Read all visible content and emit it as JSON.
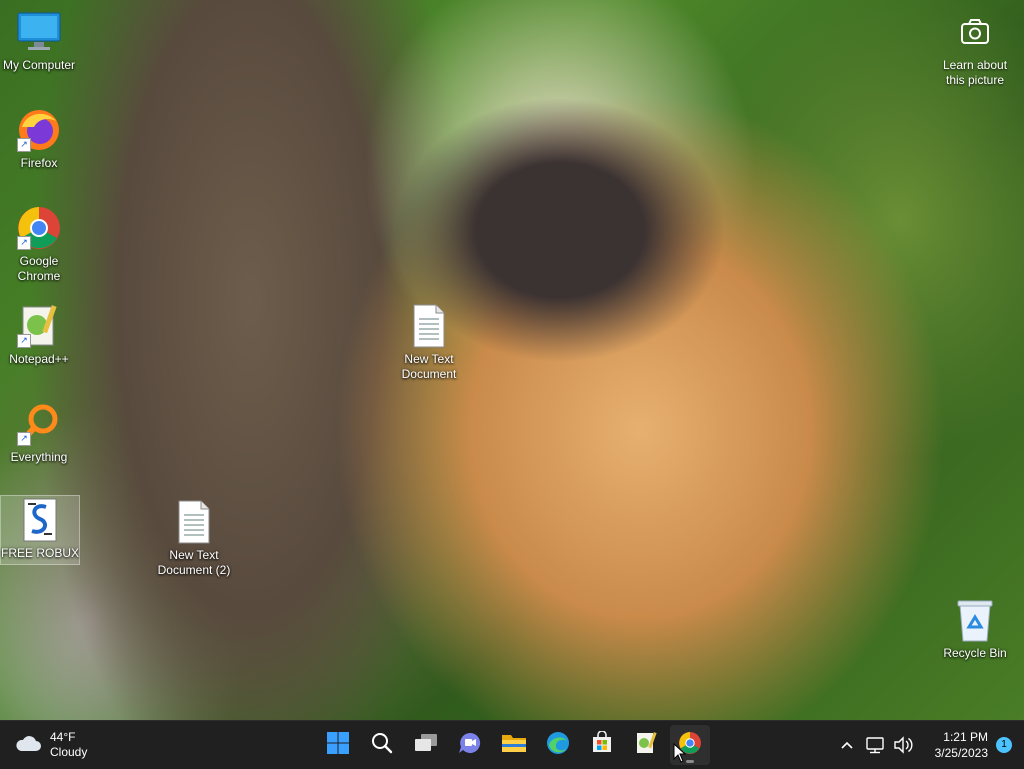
{
  "desktop": {
    "icons": [
      {
        "label": "My Computer",
        "icon": "monitor-icon"
      },
      {
        "label": "Firefox",
        "icon": "firefox-icon"
      },
      {
        "label": "Google Chrome",
        "icon": "chrome-icon"
      },
      {
        "label": "Notepad++",
        "icon": "notepadpp-icon"
      },
      {
        "label": "Everything",
        "icon": "search-everything-icon"
      },
      {
        "label": "FREE ROBUX",
        "icon": "script-file-icon"
      },
      {
        "label": "New Text Document",
        "icon": "text-file-icon"
      },
      {
        "label": "New Text Document (2)",
        "icon": "text-file-icon"
      },
      {
        "label": "Recycle Bin",
        "icon": "recycle-bin-icon"
      }
    ],
    "learn_about": "Learn about this picture"
  },
  "taskbar": {
    "weather": {
      "temp": "44°F",
      "condition": "Cloudy"
    },
    "apps": [
      "start",
      "search",
      "task-view",
      "teams",
      "file-explorer",
      "edge",
      "store",
      "notepadpp",
      "chrome"
    ],
    "clock": {
      "time": "1:21 PM",
      "date": "3/25/2023"
    },
    "notification_count": "1"
  },
  "colors": {
    "taskbar": "#202020",
    "accent": "#4cc2ff",
    "start_blue": "#3aa0ff"
  }
}
